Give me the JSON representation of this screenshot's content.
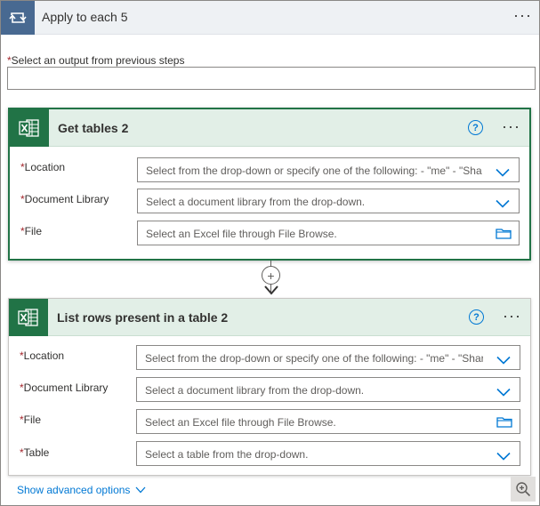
{
  "loop": {
    "title": "Apply to each 5",
    "more_label": "···",
    "prev_steps_label": "Select an output from previous steps",
    "required_mark": "*",
    "prev_steps_value": ""
  },
  "cards": [
    {
      "title": "Get tables 2",
      "help_label": "?",
      "more_label": "···",
      "fields": [
        {
          "label": "Location",
          "placeholder": "Select from the drop-down or specify one of the following: - \"me\" - \"Sha",
          "control": "dropdown"
        },
        {
          "label": "Document Library",
          "placeholder": "Select a document library from the drop-down.",
          "control": "dropdown"
        },
        {
          "label": "File",
          "placeholder": "Select an Excel file through File Browse.",
          "control": "file"
        }
      ]
    },
    {
      "title": "List rows present in a table 2",
      "help_label": "?",
      "more_label": "···",
      "fields": [
        {
          "label": "Location",
          "placeholder": "Select from the drop-down or specify one of the following: - \"me\" - \"Shar",
          "control": "dropdown"
        },
        {
          "label": "Document Library",
          "placeholder": "Select a document library from the drop-down.",
          "control": "dropdown"
        },
        {
          "label": "File",
          "placeholder": "Select an Excel file through File Browse.",
          "control": "file"
        },
        {
          "label": "Table",
          "placeholder": "Select a table from the drop-down.",
          "control": "dropdown"
        }
      ],
      "advanced_label": "Show advanced options"
    }
  ],
  "connector": {
    "plus_label": "+"
  },
  "icons": {
    "loop": "loop-icon",
    "excel": "excel-icon",
    "help": "help-icon",
    "chevron": "chevron-down-icon",
    "folder": "folder-icon",
    "zoom": "zoom-in-icon"
  },
  "colors": {
    "loop_accent": "#486991",
    "excel_green": "#217346",
    "card_header": "#e2efe7",
    "link_blue": "#0078d4",
    "required_red": "#a4262c"
  }
}
